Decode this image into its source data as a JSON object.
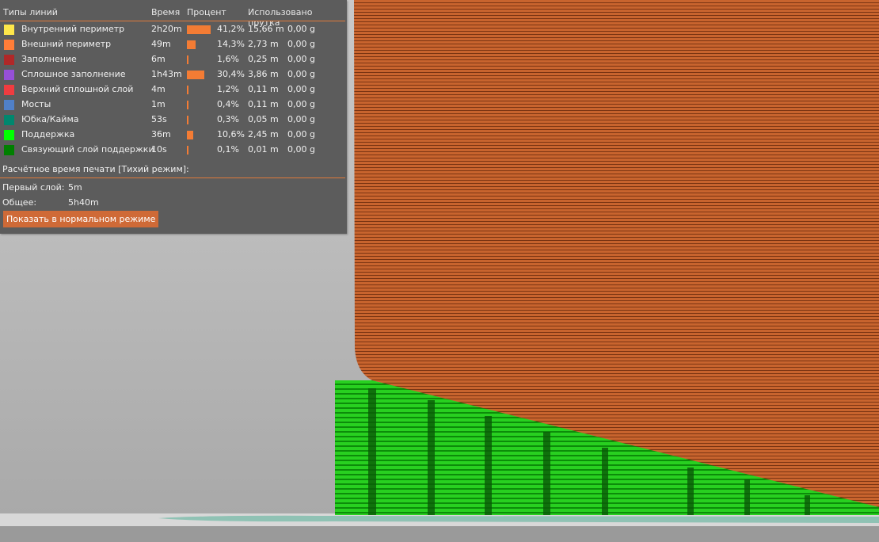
{
  "legend": {
    "headers": {
      "type": "Типы линий",
      "time": "Время",
      "percent": "Процент",
      "used": "Использовано прутка"
    },
    "rows": [
      {
        "name": "Внутренний периметр",
        "color": "#ffe74a",
        "time": "2h20m",
        "percent": 41.2,
        "percent_label": "41,2%",
        "length": "15,66 m",
        "weight": "0,00 g"
      },
      {
        "name": "Внешний периметр",
        "color": "#ff7d38",
        "time": "49m",
        "percent": 14.3,
        "percent_label": "14,3%",
        "length": "2,73 m",
        "weight": "0,00 g"
      },
      {
        "name": "Заполнение",
        "color": "#b02828",
        "time": "6m",
        "percent": 1.6,
        "percent_label": "1,6%",
        "length": "0,25 m",
        "weight": "0,00 g"
      },
      {
        "name": "Сплошное заполнение",
        "color": "#9650d8",
        "time": "1h43m",
        "percent": 30.4,
        "percent_label": "30,4%",
        "length": "3,86 m",
        "weight": "0,00 g"
      },
      {
        "name": "Верхний сплошной слой",
        "color": "#f03c40",
        "time": "4m",
        "percent": 1.2,
        "percent_label": "1,2%",
        "length": "0,11 m",
        "weight": "0,00 g"
      },
      {
        "name": "Мосты",
        "color": "#5080c8",
        "time": "1m",
        "percent": 0.4,
        "percent_label": "0,4%",
        "length": "0,11 m",
        "weight": "0,00 g"
      },
      {
        "name": "Юбка/Кайма",
        "color": "#00876e",
        "time": "53s",
        "percent": 0.3,
        "percent_label": "0,3%",
        "length": "0,05 m",
        "weight": "0,00 g"
      },
      {
        "name": "Поддержка",
        "color": "#00ff00",
        "time": "36m",
        "percent": 10.6,
        "percent_label": "10,6%",
        "length": "2,45 m",
        "weight": "0,00 g"
      },
      {
        "name": "Связующий слой поддержки",
        "color": "#008000",
        "time": "10s",
        "percent": 0.1,
        "percent_label": "0,1%",
        "length": "0,01 m",
        "weight": "0,00 g"
      }
    ],
    "estimate_title": "Расчётное время печати [Тихий режим]:",
    "first_layer_label": "Первый слой:",
    "first_layer_value": "5m",
    "total_label": "Общее:",
    "total_value": "5h40m",
    "switch_button": "Показать в нормальном режиме"
  },
  "colors": {
    "accent": "#e07a3a",
    "bar": "#f47c34",
    "object": "#c8642e",
    "support": "#22c81e"
  }
}
